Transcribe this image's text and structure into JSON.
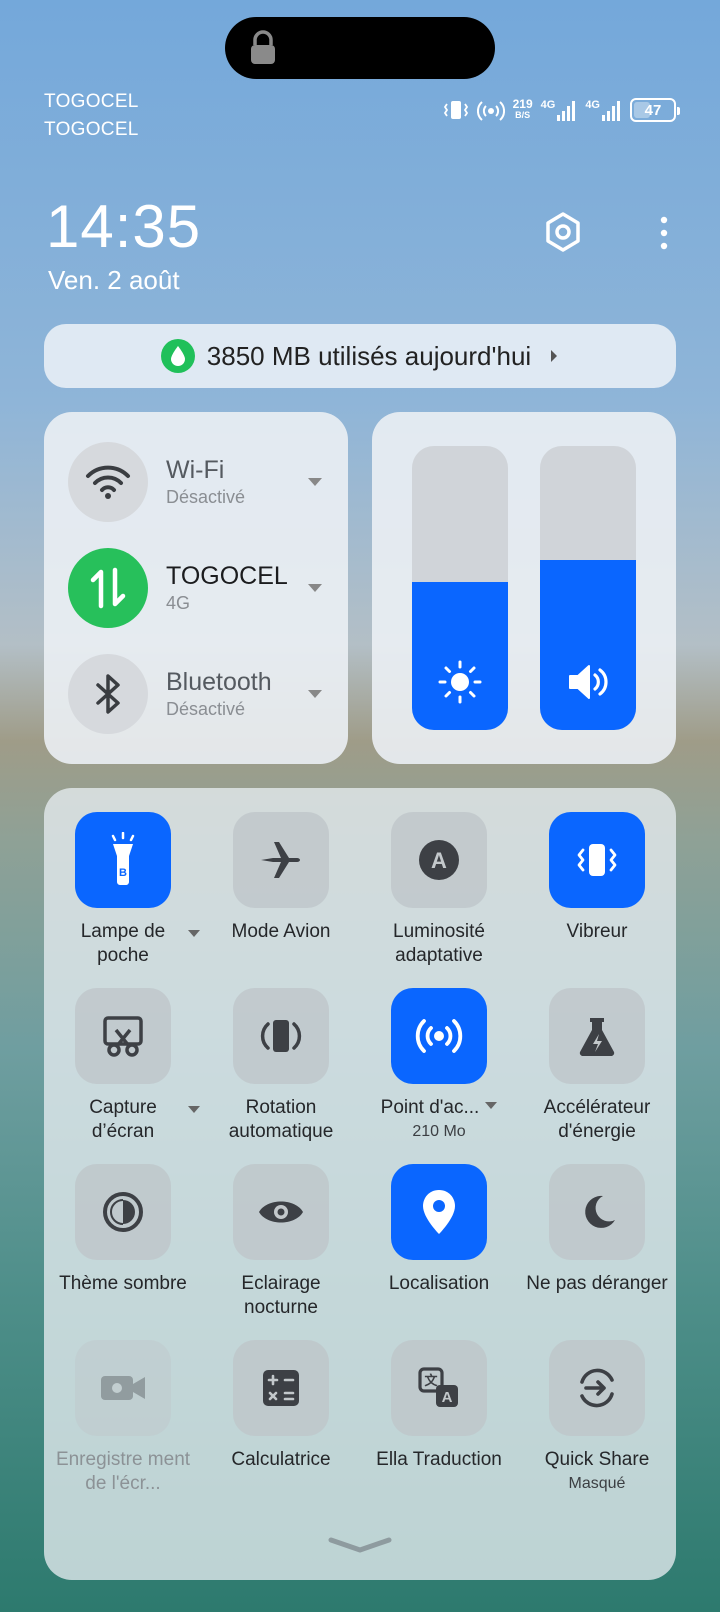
{
  "status_bar": {
    "carrier1": "TOGOCEL",
    "carrier2": "TOGOCEL",
    "net_speed_value": "219",
    "net_speed_unit": "B/S",
    "network1": "4G",
    "network2": "4G",
    "battery": "47",
    "icons": [
      "lock-icon",
      "vibrate-icon",
      "hotspot-icon",
      "signal-icon",
      "signal-icon"
    ]
  },
  "header": {
    "time": "14:35",
    "date": "Ven. 2 août"
  },
  "data_usage": {
    "text": "3850 MB utilisés aujourd'hui"
  },
  "connectivity": [
    {
      "name": "Wi-Fi",
      "status": "Désactivé",
      "icon": "wifi-icon",
      "active": false
    },
    {
      "name": "TOGOCEL",
      "status": "4G",
      "icon": "mobile-data-icon",
      "active": true
    },
    {
      "name": "Bluetooth",
      "status": "Désactivé",
      "icon": "bluetooth-icon",
      "active": false
    }
  ],
  "sliders": {
    "brightness_level": 0.52,
    "volume_level": 0.6
  },
  "tiles": [
    {
      "label": "Lampe de poche",
      "icon": "flashlight-icon",
      "active": true,
      "dropdown": true
    },
    {
      "label": "Mode Avion",
      "icon": "airplane-icon",
      "active": false
    },
    {
      "label": "Luminosité adaptative",
      "icon": "auto-brightness-icon",
      "active": false
    },
    {
      "label": "Vibreur",
      "icon": "vibrate-icon",
      "active": true
    },
    {
      "label": "Capture d’écran",
      "icon": "screenshot-icon",
      "active": false,
      "dropdown": true
    },
    {
      "label": "Rotation automatique",
      "icon": "rotation-icon",
      "active": false
    },
    {
      "label": "Point d'ac...",
      "sub": "210 Mo",
      "icon": "hotspot-icon",
      "active": true,
      "dropdown": true
    },
    {
      "label": "Accélérateur d'énergie",
      "icon": "flask-icon",
      "active": false
    },
    {
      "label": "Thème sombre",
      "icon": "dark-theme-icon",
      "active": false
    },
    {
      "label": "Eclairage nocturne",
      "icon": "eye-icon",
      "active": false
    },
    {
      "label": "Localisation",
      "icon": "location-icon",
      "active": true
    },
    {
      "label": "Ne pas déranger",
      "icon": "moon-icon",
      "active": false
    },
    {
      "label": "Enregistre ment de l'écr...",
      "icon": "screen-record-icon",
      "active": false,
      "disabled": true
    },
    {
      "label": "Calculatrice",
      "icon": "calculator-icon",
      "active": false
    },
    {
      "label": "Ella Traduction",
      "icon": "translate-icon",
      "active": false
    },
    {
      "label": "Quick Share",
      "sub": "Masqué",
      "icon": "share-icon",
      "active": false
    }
  ],
  "colors": {
    "accent": "#0a66ff",
    "mobile_active": "#27c05b",
    "data_drop": "#20c05a"
  }
}
